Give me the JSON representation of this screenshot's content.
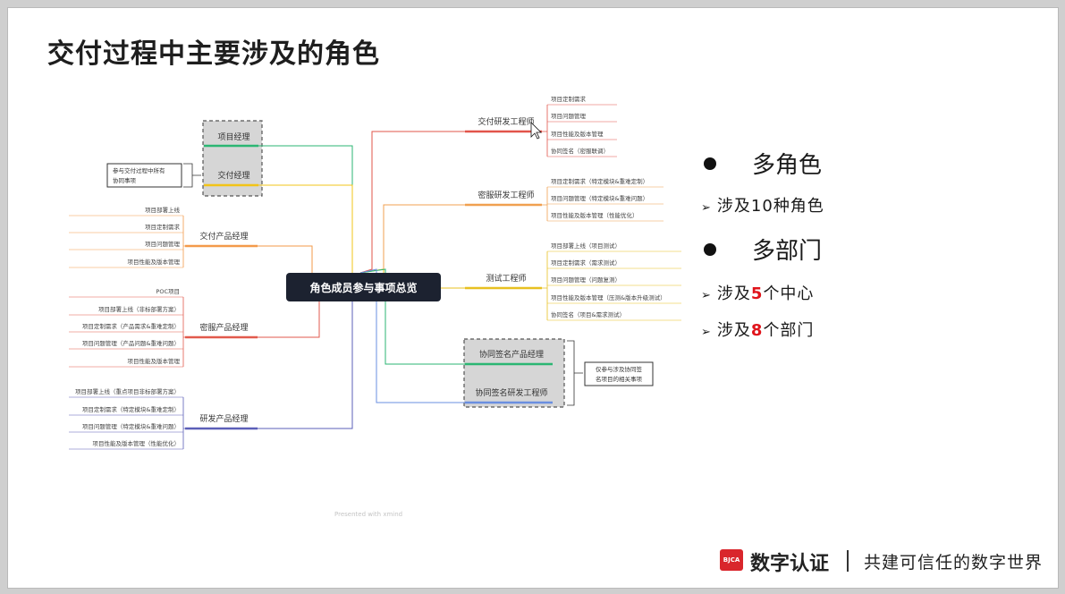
{
  "slide": {
    "title": "交付过程中主要涉及的角色"
  },
  "mindmap": {
    "center": "角色成员参与事项总览",
    "left_group_note": "参与交付过程中所有协同事项",
    "left_group_note_lines": [
      "参与交付过程中所有",
      "协同事项"
    ],
    "left_branches": [
      {
        "label": "项目经理",
        "color": "#2bb673",
        "items": []
      },
      {
        "label": "交付经理",
        "color": "#f2c418",
        "items": []
      },
      {
        "label": "交付产品经理",
        "color": "#f39a4a",
        "items": [
          "项目部署上线",
          "项目定制需求",
          "项目问题管理",
          "项目性能及版本管理"
        ]
      },
      {
        "label": "密服产品经理",
        "color": "#e25a4d",
        "items": [
          "POC项目",
          "项目部署上线（非标部署方案）",
          "项目定制需求（产品需求&重难定制）",
          "项目问题管理（产品问题&重难问题）",
          "项目性能及版本管理"
        ]
      },
      {
        "label": "研发产品经理",
        "color": "#5b5fb8",
        "items": [
          "项目部署上线（重点项目非标部署方案）",
          "项目定制需求（特定模块&重难定制）",
          "项目问题管理（特定模块&重难问题）",
          "项目性能及版本管理（性能优化）"
        ]
      }
    ],
    "right_branches": [
      {
        "label": "交付研发工程师",
        "color": "#e2544a",
        "items": [
          "项目定制需求",
          "项目问题管理",
          "项目性能及版本管理",
          "协同签名（密服联调）"
        ]
      },
      {
        "label": "密服研发工程师",
        "color": "#f0a050",
        "items": [
          "项目定制需求（特定模块&重难定制）",
          "项目问题管理（特定模块&重难问题）",
          "项目性能及版本管理（性能优化）"
        ]
      },
      {
        "label": "测试工程师",
        "color": "#e8c020",
        "items": [
          "项目部署上线（项目测试）",
          "项目定制需求（需求测试）",
          "项目问题管理（问题复测）",
          "项目性能及版本管理（压测&版本升级测试）",
          "协同签名（项目&需求测试）"
        ]
      },
      {
        "label": "协同签名产品经理",
        "color": "#2bb673",
        "items": []
      },
      {
        "label": "协同签名研发工程师",
        "color": "#6a8fe0",
        "items": []
      }
    ],
    "right_group_note": "仅参与涉及协同签名项目的相关事项",
    "right_group_note_lines": [
      "仅参与涉及协同签",
      "名项目的相关事项"
    ],
    "watermark": "Presented with xmind"
  },
  "summary": {
    "point1": "多角色",
    "point1_sub_prefix": "涉及",
    "point1_sub_num": "10",
    "point1_sub_suffix": "种角色",
    "point2": "多部门",
    "point2_sub1_prefix": "涉及",
    "point2_sub1_num": "5",
    "point2_sub1_suffix": "个中心",
    "point2_sub2_prefix": "涉及",
    "point2_sub2_num": "8",
    "point2_sub2_suffix": "个部门"
  },
  "footer": {
    "logo_text": "BJCA",
    "brand": "数字认证",
    "slogan": "共建可信任的数字世界"
  }
}
